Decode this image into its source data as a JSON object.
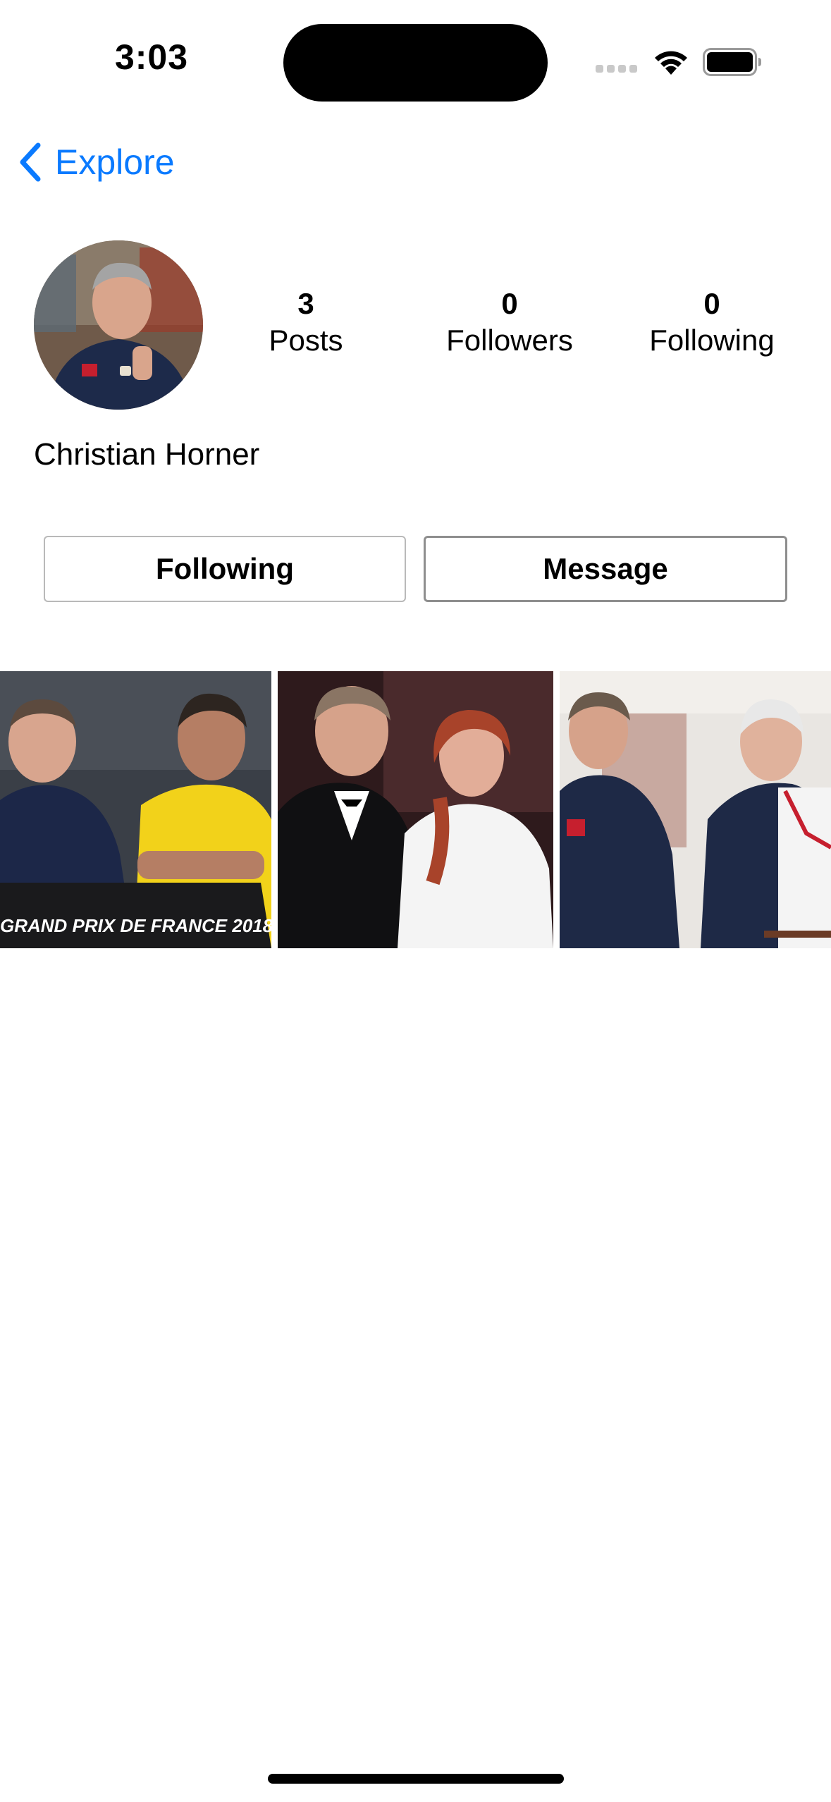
{
  "status_bar": {
    "time": "3:03"
  },
  "nav": {
    "back_label": "Explore",
    "accent_color": "#0a7aff"
  },
  "profile": {
    "name": "Christian Horner",
    "stats": [
      {
        "value": "3",
        "label": "Posts"
      },
      {
        "value": "0",
        "label": "Followers"
      },
      {
        "value": "0",
        "label": "Following"
      }
    ]
  },
  "actions": {
    "following_label": "Following",
    "message_label": "Message"
  },
  "posts": {
    "tile1_caption": "GRAND PRIX DE FRANCE 2018"
  }
}
